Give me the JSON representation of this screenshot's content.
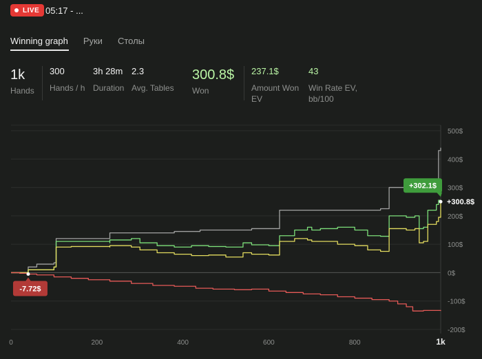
{
  "header": {
    "live_label": "LIVE",
    "session_time": "05:17 - ...",
    "live_color": "#e53935"
  },
  "tabs": [
    {
      "label": "Winning graph",
      "active": true
    },
    {
      "label": "Руки",
      "active": false
    },
    {
      "label": "Столы",
      "active": false
    }
  ],
  "stats": {
    "hands": {
      "value": "1k",
      "label": "Hands"
    },
    "hands_per_hour": {
      "value": "300",
      "label": "Hands / h"
    },
    "duration": {
      "value": "3h 28m",
      "label": "Duration"
    },
    "avg_tables": {
      "value": "2.3",
      "label": "Avg. Tables"
    },
    "won": {
      "value": "300.8$",
      "label": "Won",
      "color": "#b9f4a4"
    },
    "amount_won_ev": {
      "value": "237.1$",
      "label_line1": "Amount Won",
      "label_line2": "EV",
      "color": "#b9f4a4"
    },
    "win_rate_ev": {
      "value": "43",
      "label_line1": "Win Rate EV,",
      "label_line2": "bb/100",
      "color": "#b9f4a4"
    }
  },
  "chart_data": {
    "type": "line",
    "xlim": [
      0,
      1000
    ],
    "ylim": [
      -200,
      500
    ],
    "x_ticks": [
      "0",
      "200",
      "400",
      "600",
      "800",
      "1k"
    ],
    "x_tick_values": [
      0,
      200,
      400,
      600,
      800,
      1000
    ],
    "y_ticks": [
      "500$",
      "400$",
      "300$",
      "200$",
      "100$",
      "0$",
      "-100$",
      "-200$"
    ],
    "y_tick_values": [
      500,
      400,
      300,
      200,
      100,
      0,
      -100,
      -200
    ],
    "grid": true,
    "annotations": {
      "max_label": "+302.1$",
      "final_label": "+300.8$",
      "min_label": "-7.72$"
    },
    "series": [
      {
        "color": "#a2a3a2",
        "points": [
          [
            0,
            0
          ],
          [
            20,
            -2
          ],
          [
            40,
            20
          ],
          [
            60,
            30
          ],
          [
            100,
            35
          ],
          [
            105,
            120
          ],
          [
            150,
            120
          ],
          [
            230,
            120
          ],
          [
            230,
            140
          ],
          [
            380,
            145
          ],
          [
            440,
            150
          ],
          [
            560,
            155
          ],
          [
            625,
            160
          ],
          [
            625,
            220
          ],
          [
            700,
            220
          ],
          [
            860,
            225
          ],
          [
            880,
            225
          ],
          [
            880,
            300
          ],
          [
            920,
            300
          ],
          [
            930,
            305
          ],
          [
            950,
            300
          ],
          [
            960,
            310
          ],
          [
            990,
            310
          ],
          [
            995,
            430
          ],
          [
            1000,
            440
          ]
        ]
      },
      {
        "color": "#7de07a",
        "points": [
          [
            0,
            0
          ],
          [
            35,
            0
          ],
          [
            40,
            10
          ],
          [
            100,
            20
          ],
          [
            105,
            110
          ],
          [
            140,
            110
          ],
          [
            230,
            105
          ],
          [
            230,
            115
          ],
          [
            260,
            115
          ],
          [
            280,
            120
          ],
          [
            300,
            105
          ],
          [
            340,
            95
          ],
          [
            380,
            90
          ],
          [
            420,
            95
          ],
          [
            460,
            92
          ],
          [
            500,
            90
          ],
          [
            540,
            105
          ],
          [
            560,
            98
          ],
          [
            600,
            95
          ],
          [
            625,
            100
          ],
          [
            625,
            130
          ],
          [
            660,
            150
          ],
          [
            690,
            160
          ],
          [
            700,
            150
          ],
          [
            720,
            155
          ],
          [
            760,
            160
          ],
          [
            800,
            150
          ],
          [
            830,
            130
          ],
          [
            860,
            128
          ],
          [
            880,
            130
          ],
          [
            880,
            200
          ],
          [
            900,
            200
          ],
          [
            920,
            195
          ],
          [
            940,
            200
          ],
          [
            950,
            155
          ],
          [
            960,
            160
          ],
          [
            970,
            220
          ],
          [
            990,
            240
          ],
          [
            995,
            255
          ],
          [
            1000,
            250
          ]
        ]
      },
      {
        "color": "#e3dc5f",
        "points": [
          [
            0,
            0
          ],
          [
            35,
            0
          ],
          [
            40,
            10
          ],
          [
            100,
            20
          ],
          [
            105,
            90
          ],
          [
            140,
            92
          ],
          [
            230,
            90
          ],
          [
            230,
            95
          ],
          [
            260,
            95
          ],
          [
            280,
            90
          ],
          [
            300,
            80
          ],
          [
            340,
            70
          ],
          [
            380,
            65
          ],
          [
            420,
            60
          ],
          [
            460,
            62
          ],
          [
            500,
            55
          ],
          [
            540,
            70
          ],
          [
            560,
            65
          ],
          [
            600,
            62
          ],
          [
            625,
            65
          ],
          [
            625,
            110
          ],
          [
            660,
            120
          ],
          [
            690,
            115
          ],
          [
            700,
            110
          ],
          [
            720,
            110
          ],
          [
            760,
            100
          ],
          [
            800,
            95
          ],
          [
            830,
            80
          ],
          [
            860,
            75
          ],
          [
            880,
            80
          ],
          [
            880,
            155
          ],
          [
            900,
            155
          ],
          [
            920,
            150
          ],
          [
            940,
            155
          ],
          [
            950,
            105
          ],
          [
            960,
            110
          ],
          [
            970,
            170
          ],
          [
            990,
            180
          ],
          [
            995,
            195
          ],
          [
            1000,
            245
          ]
        ]
      },
      {
        "color": "#e65a57",
        "points": [
          [
            0,
            0
          ],
          [
            20,
            -2
          ],
          [
            40,
            -5
          ],
          [
            60,
            -8
          ],
          [
            100,
            -15
          ],
          [
            140,
            -20
          ],
          [
            180,
            -25
          ],
          [
            230,
            -30
          ],
          [
            280,
            -38
          ],
          [
            330,
            -45
          ],
          [
            380,
            -48
          ],
          [
            430,
            -55
          ],
          [
            470,
            -58
          ],
          [
            520,
            -60
          ],
          [
            560,
            -58
          ],
          [
            600,
            -65
          ],
          [
            640,
            -70
          ],
          [
            680,
            -75
          ],
          [
            720,
            -78
          ],
          [
            760,
            -85
          ],
          [
            800,
            -90
          ],
          [
            840,
            -95
          ],
          [
            880,
            -100
          ],
          [
            900,
            -110
          ],
          [
            920,
            -120
          ],
          [
            935,
            -135
          ],
          [
            960,
            -133
          ],
          [
            1000,
            -135
          ]
        ]
      }
    ]
  }
}
